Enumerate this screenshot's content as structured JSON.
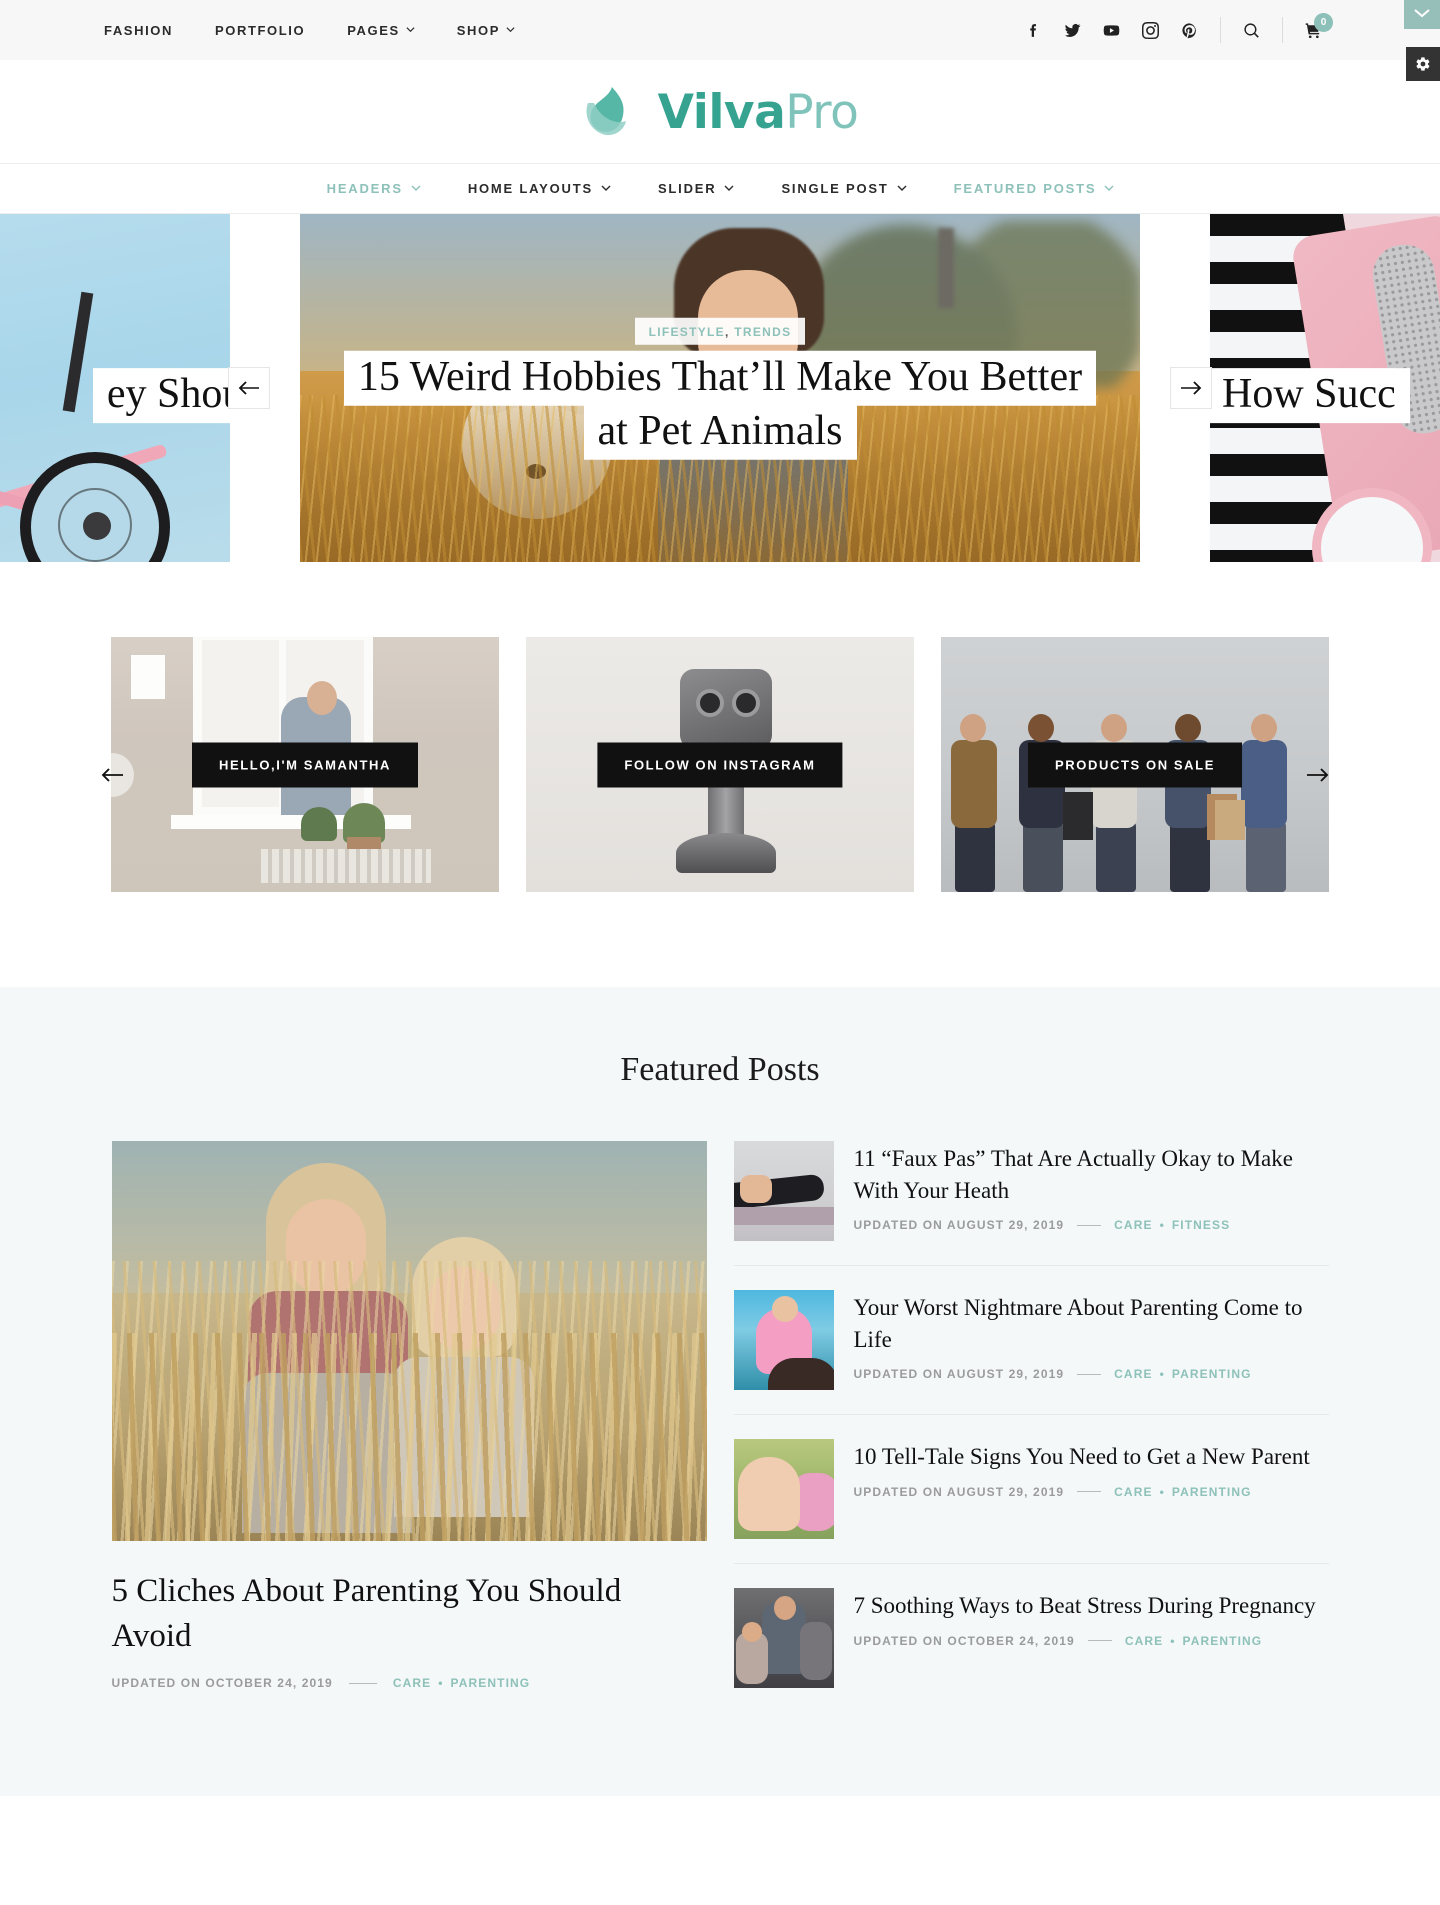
{
  "topbar": {
    "nav": [
      {
        "label": "FASHION",
        "has_dropdown": false
      },
      {
        "label": "PORTFOLIO",
        "has_dropdown": false
      },
      {
        "label": "PAGES",
        "has_dropdown": true
      },
      {
        "label": "SHOP",
        "has_dropdown": true
      }
    ],
    "socials": [
      {
        "name": "facebook-icon",
        "title": "Facebook"
      },
      {
        "name": "twitter-icon",
        "title": "Twitter"
      },
      {
        "name": "youtube-icon",
        "title": "YouTube"
      },
      {
        "name": "instagram-icon",
        "title": "Instagram"
      },
      {
        "name": "pinterest-icon",
        "title": "Pinterest"
      }
    ],
    "search_icon": "search-icon",
    "cart_icon": "cart-icon",
    "cart_count": "0",
    "scroll_toggle_icon": "chevron-down-icon"
  },
  "brand": {
    "name_bold": "Vilva",
    "name_light": "Pro",
    "logo_icon": "leaf-logo-icon",
    "colors": {
      "dark_teal": "#36a391",
      "light_teal": "#7fc3bb"
    }
  },
  "settings_button": {
    "icon": "gear-icon",
    "label": "Settings"
  },
  "mainnav": {
    "items": [
      {
        "label": "HEADERS",
        "active": true
      },
      {
        "label": "HOME LAYOUTS",
        "active": false
      },
      {
        "label": "SLIDER",
        "active": false
      },
      {
        "label": "SINGLE POST",
        "active": false
      },
      {
        "label": "FEATURED POSTS",
        "active": true
      }
    ]
  },
  "slider": {
    "prev_label": "←",
    "next_label": "→",
    "left_slide": {
      "title_fragment": "ey Should"
    },
    "center_slide": {
      "categories": [
        "LIFESTYLE",
        "TRENDS"
      ],
      "separator": ",",
      "title_line1": "15 Weird Hobbies That’ll Make You Better",
      "title_line2": "at Pet Animals"
    },
    "right_slide": {
      "title_fragment": "How Succ"
    }
  },
  "promos": {
    "prev_label": "←",
    "next_label": "→",
    "boxes": [
      {
        "label": "HELLO,I'M SAMANTHA"
      },
      {
        "label": "FOLLOW ON INSTAGRAM"
      },
      {
        "label": "PRODUCTS ON SALE"
      }
    ]
  },
  "featured": {
    "heading": "Featured Posts",
    "main_post": {
      "title": "5 Cliches About Parenting You Should Avoid",
      "updated": "UPDATED ON OCTOBER 24, 2019",
      "categories": [
        "CARE",
        "PARENTING"
      ]
    },
    "list": [
      {
        "title": "11 “Faux Pas” That Are Actually Okay to Make With Your Heath",
        "updated": "UPDATED ON AUGUST 29, 2019",
        "categories": [
          "CARE",
          "FITNESS"
        ]
      },
      {
        "title": "Your Worst Nightmare About Parenting Come to Life",
        "updated": "UPDATED ON AUGUST 29, 2019",
        "categories": [
          "CARE",
          "PARENTING"
        ]
      },
      {
        "title": "10 Tell-Tale Signs You Need to Get a New Parent",
        "updated": "UPDATED ON AUGUST 29, 2019",
        "categories": [
          "CARE",
          "PARENTING"
        ]
      },
      {
        "title": "7 Soothing Ways to Beat Stress During Pregnancy",
        "updated": "UPDATED ON OCTOBER 24, 2019",
        "categories": [
          "CARE",
          "PARENTING"
        ]
      }
    ],
    "meta_separator": "•"
  },
  "theme": {
    "accent": "#8dc1b9",
    "topbar_bg": "#f7f7f7",
    "featured_bg": "#f4f8f8"
  }
}
